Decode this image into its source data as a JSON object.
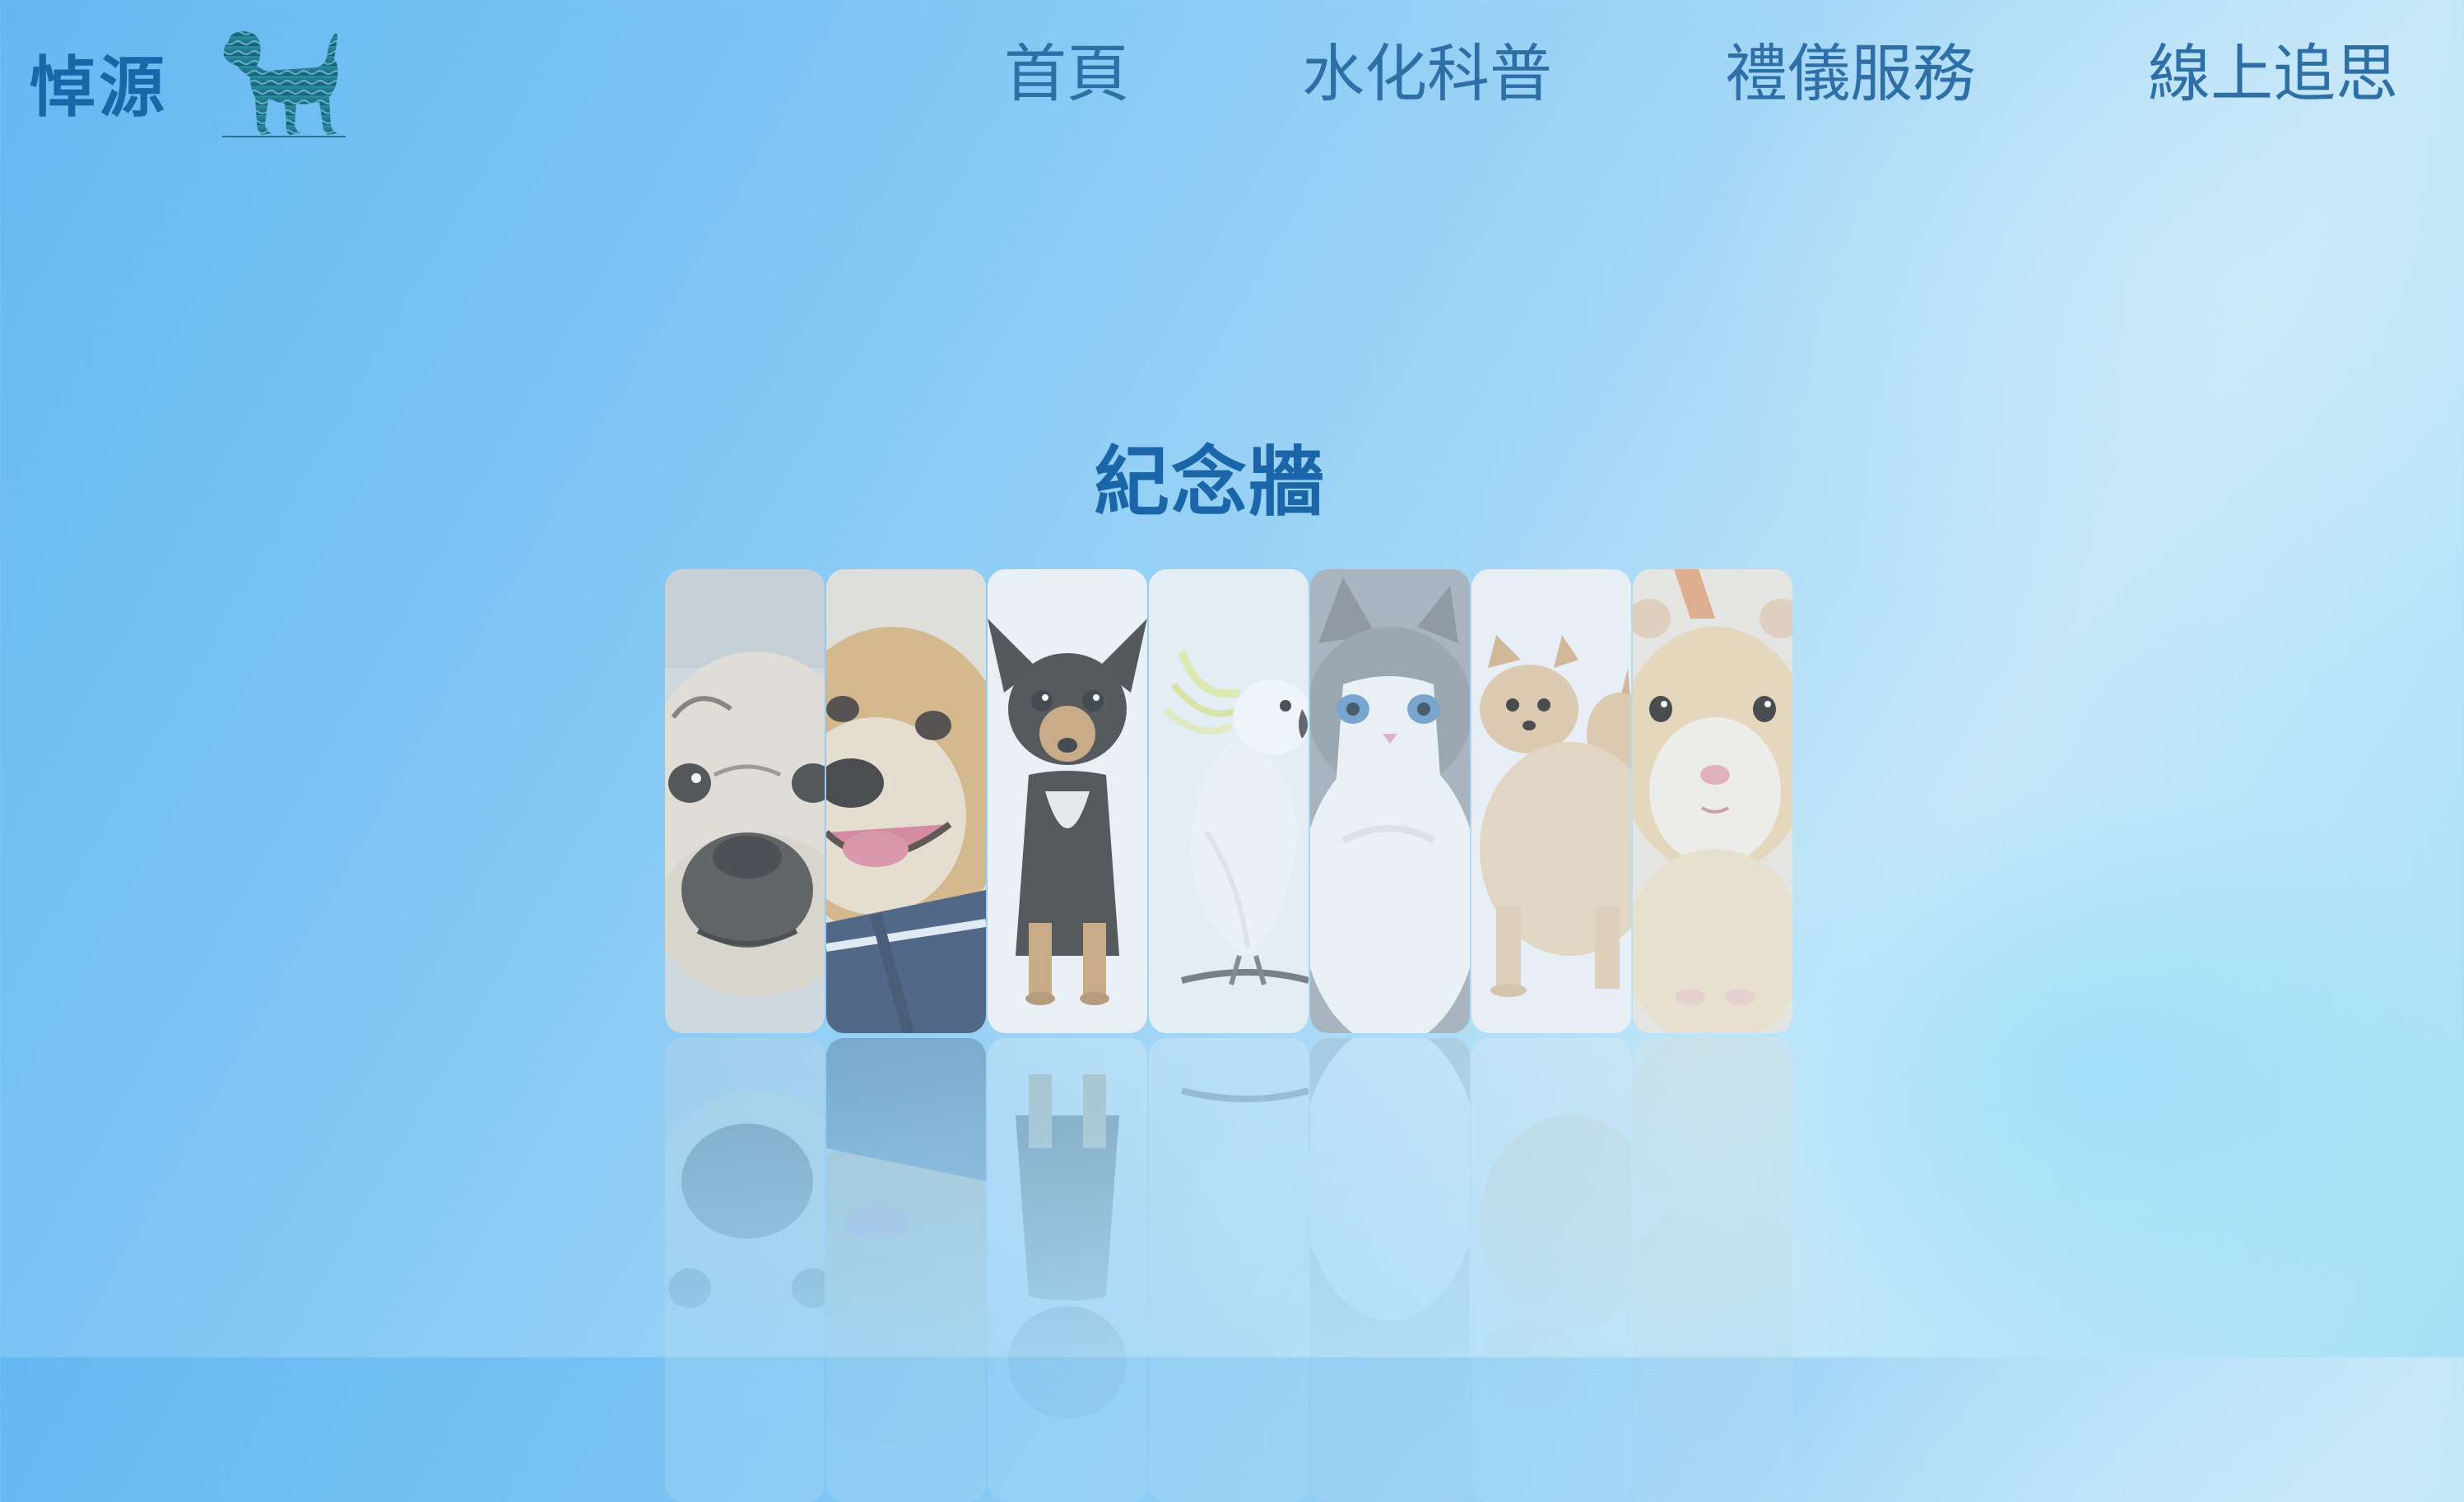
{
  "brand": {
    "name": "悼源",
    "logo_icon": "dog-silhouette-icon"
  },
  "nav": {
    "items": [
      {
        "label": "首頁"
      },
      {
        "label": "水化科普"
      },
      {
        "label": "禮儀服務"
      },
      {
        "label": "線上追思"
      }
    ]
  },
  "page": {
    "title": "紀念牆"
  },
  "gallery": {
    "cards": [
      {
        "subject": "pug-photo"
      },
      {
        "subject": "shiba-inu-photo"
      },
      {
        "subject": "chihuahua-photo"
      },
      {
        "subject": "cockatoo-photo"
      },
      {
        "subject": "ragdoll-cat-photo"
      },
      {
        "subject": "pomeranian-photo"
      },
      {
        "subject": "hamster-photo"
      }
    ]
  },
  "colors": {
    "brand": "#1b66a8",
    "nav_text": "#2e6fa8"
  }
}
